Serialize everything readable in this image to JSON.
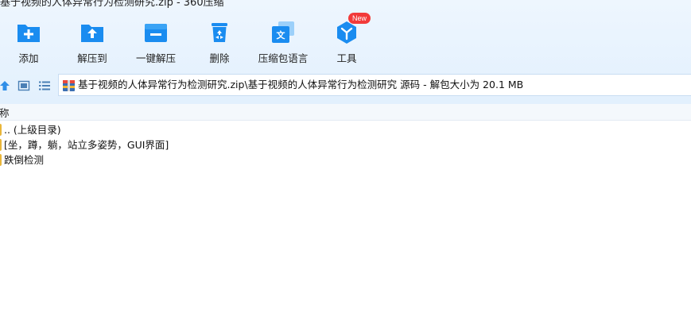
{
  "window": {
    "title": "基于视频的人体异常行为检测研究.zip - 360压缩"
  },
  "toolbar": {
    "items": [
      {
        "id": "add",
        "label": "添加"
      },
      {
        "id": "extract-to",
        "label": "解压到"
      },
      {
        "id": "one-click-extract",
        "label": "一键解压"
      },
      {
        "id": "delete",
        "label": "删除"
      },
      {
        "id": "language",
        "label": "压缩包语言"
      },
      {
        "id": "tools",
        "label": "工具",
        "badge": "New"
      }
    ]
  },
  "address": {
    "path": "基于视频的人体异常行为检测研究.zip\\基于视频的人体异常行为检测研究 源码 - 解包大小为 20.1 MB"
  },
  "list": {
    "header_name": "称",
    "rows": [
      {
        "name": ".. (上级目录)"
      },
      {
        "name": "[坐，蹲，躺，站立多姿势，GUI界面]"
      },
      {
        "name": "跌倒检测"
      }
    ]
  },
  "colors": {
    "accent": "#1a8cf0",
    "toolbar_bg": "#e6f2fd",
    "badge": "#f23a3a",
    "folder": "#e9b63a"
  }
}
